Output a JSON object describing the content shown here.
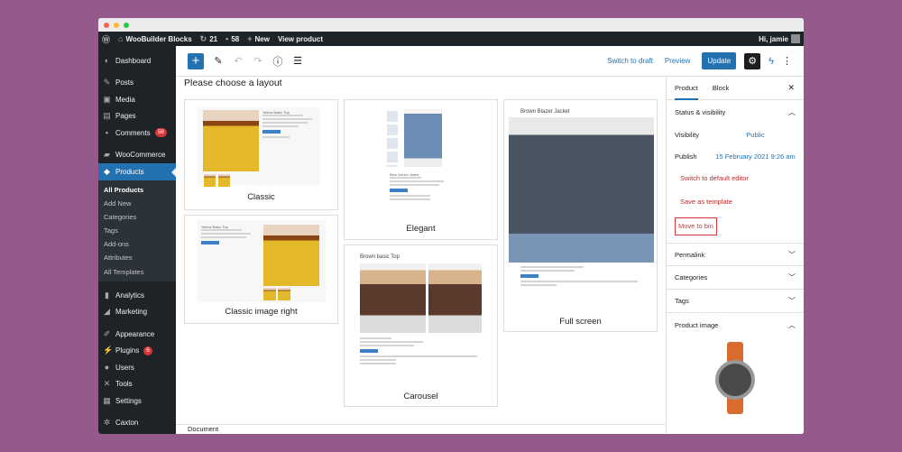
{
  "adminbar": {
    "site": "WooBuilder Blocks",
    "updates": "21",
    "comments": "58",
    "new": "New",
    "view": "View product",
    "greeting": "Hi, jamie"
  },
  "sidebar": {
    "items": [
      {
        "label": "Dashboard",
        "icon": "dashboard-icon"
      },
      {
        "label": "Posts",
        "icon": "pin-icon"
      },
      {
        "label": "Media",
        "icon": "media-icon"
      },
      {
        "label": "Pages",
        "icon": "page-icon"
      },
      {
        "label": "Comments",
        "icon": "comment-icon",
        "badge": "58"
      },
      {
        "label": "WooCommerce",
        "icon": "woo-icon"
      },
      {
        "label": "Products",
        "icon": "box-icon"
      }
    ],
    "submenu": [
      "All Products",
      "Add New",
      "Categories",
      "Tags",
      "Add-ons",
      "Attributes",
      "All Templates"
    ],
    "items2": [
      {
        "label": "Analytics",
        "icon": "chart-icon"
      },
      {
        "label": "Marketing",
        "icon": "megaphone-icon"
      },
      {
        "label": "Appearance",
        "icon": "brush-icon"
      },
      {
        "label": "Plugins",
        "icon": "plug-icon",
        "badge": "6"
      },
      {
        "label": "Users",
        "icon": "user-icon"
      },
      {
        "label": "Tools",
        "icon": "wrench-icon"
      },
      {
        "label": "Settings",
        "icon": "settings-icon"
      },
      {
        "label": "Caxton",
        "icon": "gear-icon"
      }
    ]
  },
  "toolbar": {
    "switch_draft": "Switch to draft",
    "preview": "Preview",
    "update": "Update"
  },
  "main": {
    "title": "Please choose a layout",
    "cards": {
      "classic": "Classic",
      "elegant": "Elegant",
      "fullscreen": "Full screen",
      "classic_right": "Classic image right",
      "carousel": "Carousel"
    },
    "thumb_titles": {
      "classic": "Yellow Basic Top",
      "elegant": "Blue Denim Jeans",
      "fullscreen": "Brown Blazer Jacket",
      "classic_right": "Yellow Basic Top",
      "carousel": "Brown basic Top"
    }
  },
  "settings": {
    "tab_product": "Product",
    "tab_block": "Block",
    "status_visibility": "Status & visibility",
    "visibility_label": "Visibility",
    "visibility_value": "Public",
    "publish_label": "Publish",
    "publish_value": "15 February 2021 9:26 am",
    "switch_editor": "Switch to default editor",
    "save_template": "Save as template",
    "move_bin": "Move to bin",
    "panels": [
      "Permalink",
      "Categories",
      "Tags",
      "Product image"
    ]
  },
  "footer": {
    "breadcrumb": "Document"
  }
}
